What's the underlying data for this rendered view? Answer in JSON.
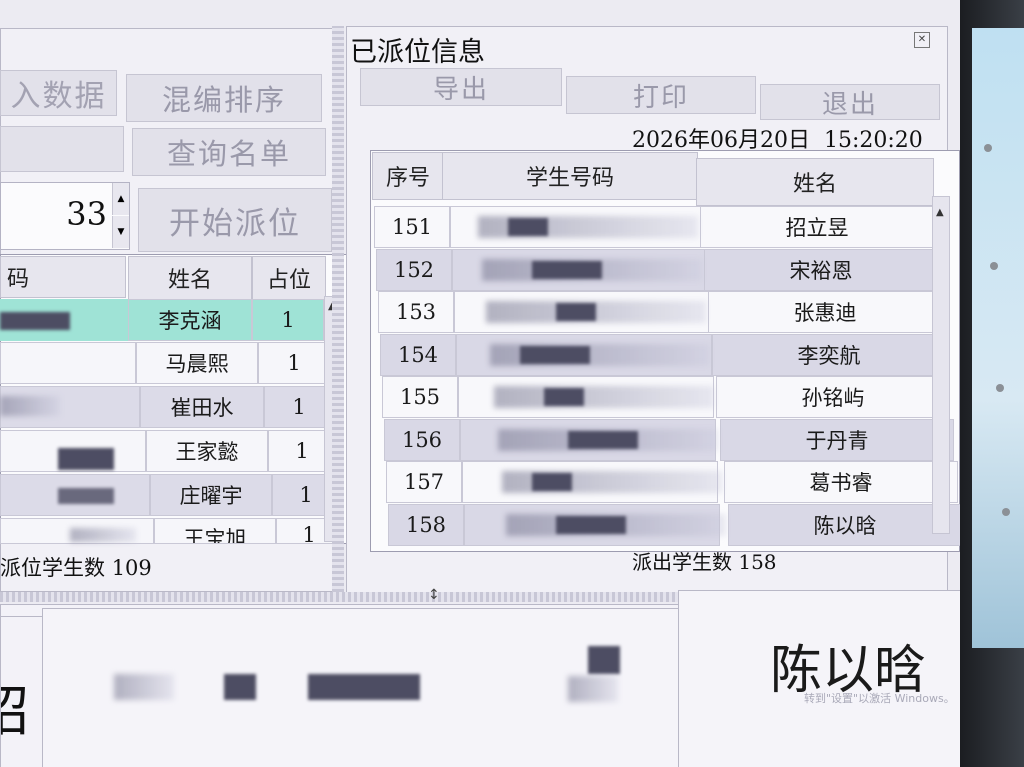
{
  "left": {
    "btn_data_partial": "入数据",
    "btn_mix_sort": "混编排序",
    "btn_query_list": "查询名单",
    "btn_start_assign": "开始派位",
    "stepper_value": "33",
    "table": {
      "headers": [
        "码",
        "姓名",
        "占位"
      ],
      "rows": [
        {
          "name": "李克涵",
          "seats": "1"
        },
        {
          "name": "马晨熙",
          "seats": "1"
        },
        {
          "name": "崔田水",
          "seats": "1"
        },
        {
          "name": "王家懿",
          "seats": "1"
        },
        {
          "name": "庄曜宇",
          "seats": "1"
        },
        {
          "name": "王宝旭",
          "seats": "1"
        }
      ]
    },
    "footer_label": "派位学生数",
    "footer_value": "109"
  },
  "right": {
    "title": "已派位信息",
    "btn_export": "导出",
    "btn_print": "打印",
    "btn_exit": "退出",
    "datetime": "2026年06月20日  15:20:20",
    "table": {
      "headers": [
        "序号",
        "学生号码",
        "姓名"
      ],
      "rows": [
        {
          "no": "151",
          "name": "招立昱"
        },
        {
          "no": "152",
          "name": "宋裕恩"
        },
        {
          "no": "153",
          "name": "张惠迪"
        },
        {
          "no": "154",
          "name": "李奕航"
        },
        {
          "no": "155",
          "name": "孙铭屿"
        },
        {
          "no": "156",
          "name": "于丹青"
        },
        {
          "no": "157",
          "name": "葛书睿"
        },
        {
          "no": "158",
          "name": "陈以晗"
        }
      ]
    },
    "footer_label": "派出学生数",
    "footer_value": "158"
  },
  "bottom": {
    "current_name": "陈以晗",
    "left_char": "昭",
    "watermark": "转到\"设置\"以激活 Windows。"
  }
}
